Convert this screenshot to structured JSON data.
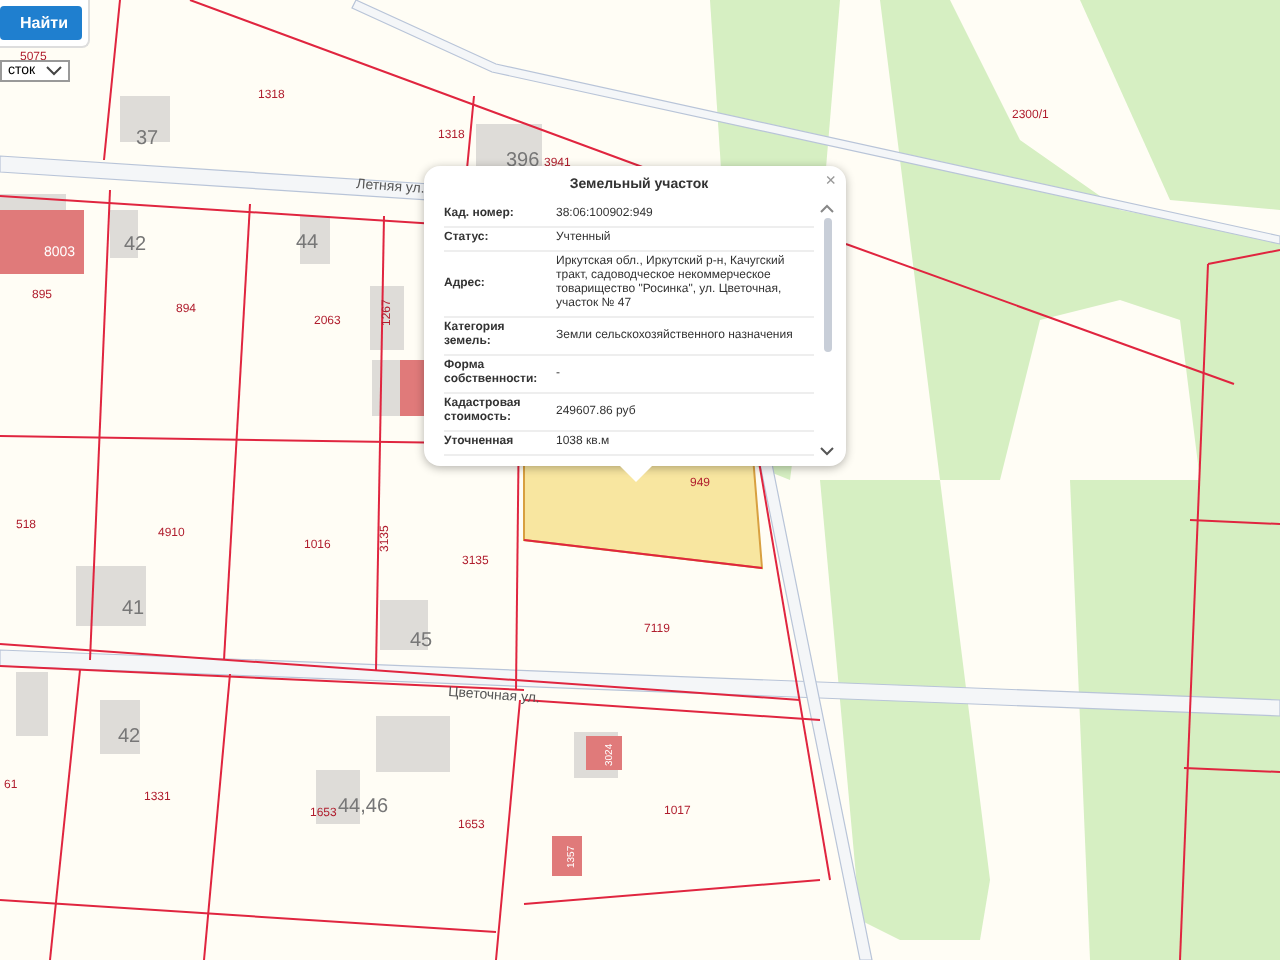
{
  "toolbar": {
    "search_button": "Найти",
    "type_select": {
      "value": "сток"
    }
  },
  "map": {
    "labels": [
      {
        "kind": "parcel",
        "text": "5075"
      },
      {
        "kind": "parcel",
        "text": "1318"
      },
      {
        "kind": "parcel",
        "text": "1318"
      },
      {
        "kind": "parcel",
        "text": "3941"
      },
      {
        "kind": "parcel",
        "text": "895"
      },
      {
        "kind": "parcel",
        "text": "894"
      },
      {
        "kind": "parcel",
        "text": "2063"
      },
      {
        "kind": "parcel",
        "text": "1267"
      },
      {
        "kind": "parcel",
        "text": "2300/1"
      },
      {
        "kind": "parcel",
        "text": "949"
      },
      {
        "kind": "parcel",
        "text": "518"
      },
      {
        "kind": "parcel",
        "text": "4910"
      },
      {
        "kind": "parcel",
        "text": "1016"
      },
      {
        "kind": "parcel",
        "text": "3135"
      },
      {
        "kind": "parcel",
        "text": "3135"
      },
      {
        "kind": "parcel",
        "text": "7119"
      },
      {
        "kind": "parcel",
        "text": "61"
      },
      {
        "kind": "parcel",
        "text": "1331"
      },
      {
        "kind": "parcel",
        "text": "1653"
      },
      {
        "kind": "parcel",
        "text": "1653"
      },
      {
        "kind": "parcel",
        "text": "1017"
      },
      {
        "kind": "house",
        "text": "37"
      },
      {
        "kind": "house",
        "text": "396"
      },
      {
        "kind": "house",
        "text": "42"
      },
      {
        "kind": "house",
        "text": "44"
      },
      {
        "kind": "house",
        "text": "41"
      },
      {
        "kind": "house",
        "text": "45"
      },
      {
        "kind": "house",
        "text": "42"
      },
      {
        "kind": "house",
        "text": "44,46"
      },
      {
        "kind": "building",
        "text": "8003"
      },
      {
        "kind": "building",
        "text": "3024"
      },
      {
        "kind": "building",
        "text": "1357"
      },
      {
        "kind": "street",
        "text": "Летняя ул."
      },
      {
        "kind": "street",
        "text": "Цветочная ул."
      }
    ]
  },
  "popup": {
    "title": "Земельный участок",
    "close": "×",
    "rows": [
      {
        "label": "Кад. номер:",
        "value": "38:06:100902:949"
      },
      {
        "label": "Статус:",
        "value": "Учтенный"
      },
      {
        "label": "Адрес:",
        "value": "Иркутская обл., Иркутский р-н, Качугский тракт, садоводческое некоммерческое товарищество \"Росинка\", ул. Цветочная, участок № 47"
      },
      {
        "label": "Категория земель:",
        "value": "Земли сельскохозяйственного назначения"
      },
      {
        "label": "Форма собственности:",
        "value": "-"
      },
      {
        "label": "Кадастровая стоимость:",
        "value": "249607.86 руб"
      },
      {
        "label": "Уточненная",
        "value": "1038 кв.м"
      }
    ]
  }
}
